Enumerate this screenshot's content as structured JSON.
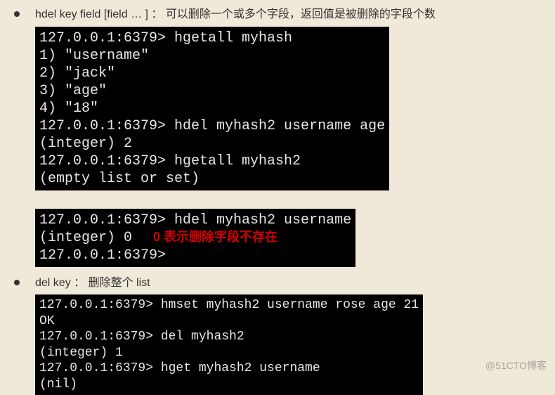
{
  "bullets": {
    "hdel": "hdel key field [field … ] ： 可以删除一个或多个字段，返回值是被删除的字段个数",
    "del": "del key ： 删除整个 list"
  },
  "terminal1": {
    "l0": "127.0.0.1:6379> hgetall myhash",
    "l1": "1) \"username\"",
    "l2": "2) \"jack\"",
    "l3": "3) \"age\"",
    "l4": "4) \"18\"",
    "l5": "127.0.0.1:6379> hdel myhash2 username age",
    "l6": "(integer) 2",
    "l7": "127.0.0.1:6379> hgetall myhash2",
    "l8": "(empty list or set)"
  },
  "terminal2": {
    "l0": "127.0.0.1:6379> hdel myhash2 username",
    "l1a": "(integer) 0",
    "l1b_annot": "0 表示删除字段不存在",
    "l2": "127.0.0.1:6379>"
  },
  "terminal3": {
    "l0": "127.0.0.1:6379> hmset myhash2 username rose age 21",
    "l1": "OK",
    "l2": "127.0.0.1:6379> del myhash2",
    "l3": "(integer) 1",
    "l4": "127.0.0.1:6379> hget myhash2 username",
    "l5": "(nil)"
  },
  "watermark": "@51CTO博客"
}
